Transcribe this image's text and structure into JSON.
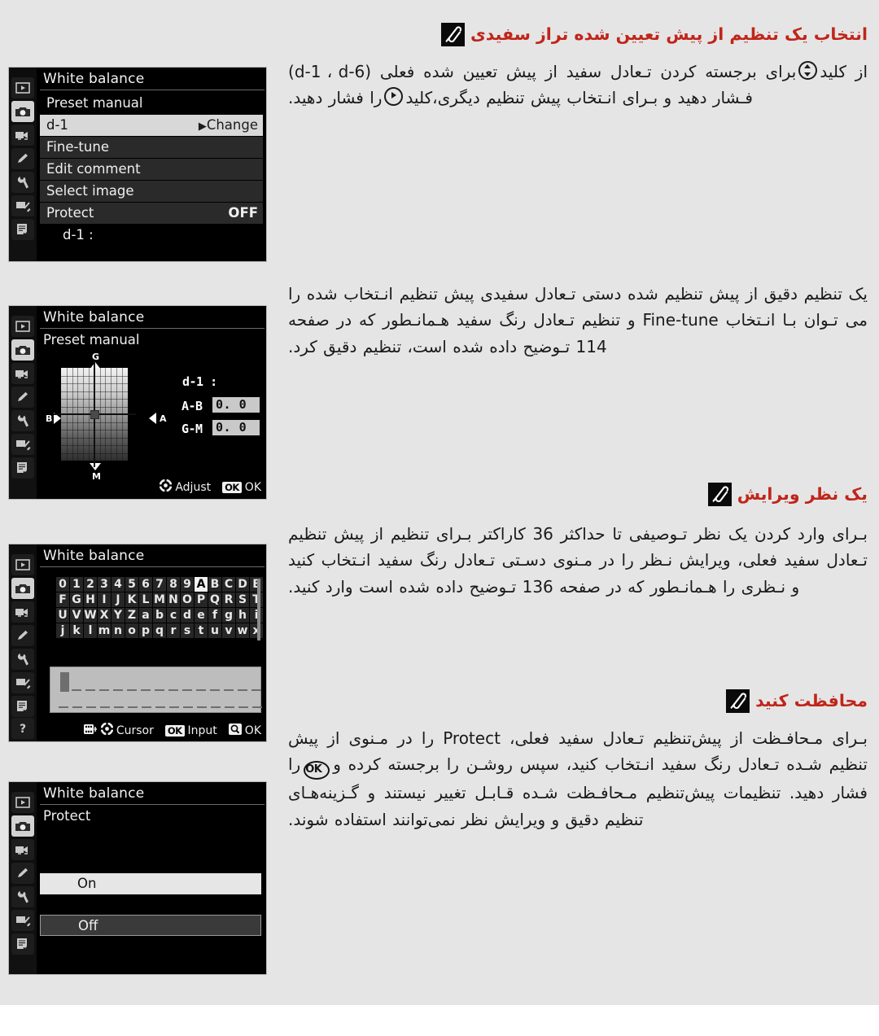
{
  "theme": {
    "page_bg": "#e5e5e5",
    "heading_red": "#c0251a",
    "lcd_black": "#000000",
    "highlight_gray": "#d8d8d8"
  },
  "sections": [
    {
      "heading": "انتخاب یک تنظیم از پیش تعیین شده تراز سفیدی",
      "paragraph_parts": {
        "a": "از کلید",
        "b": "برای برجسته کردن تـعادل سفید از پیش تعیین شده فعلی (",
        "c": "d-1 ، d-6",
        "d": ") فـشار دهید و بـرای انـتخاب پیش تنظیم دیگری،کلید",
        "e": "را فشار دهید."
      }
    },
    {
      "heading": "",
      "paragraph": "یک تنظیم دقیق از پیش تنظیم شده دستی تـعادل سفیدی پیش تنظیم انـتخاب شده را می تـوان بـا انـتخاب Fine-tune و تنظیم تـعادل رنگ سفید هـمانـطور که در صفحه 114 تـوضیح داده شده است، تنظیم دقیق کرد."
    },
    {
      "heading": "یک نظر ویرایش",
      "paragraph": "بـرای وارد کردن یک نظر تـوصیفی تا حداکثر 36 کاراکتر بـرای تنظیم از پیش تنظیم تـعادل سفید فعلی، ویرایش نـظر را در مـنوی دسـتی تـعادل رنگ سفید انـتخاب کنید و نـظری را هـمانـطور که در صفحه 136 تـوضیح داده شده است وارد کنید."
    },
    {
      "heading": "محافظت کنید",
      "paragraph_parts": {
        "a": "بـرای مـحافـظت از پیش‌تنظیم تـعادل سفید فعلی، Protect را در مـنوی از پیش تنظیم شـده تـعادل رنگ سفید انـتخاب کنید، سپس روشـن را برجسته کرده و",
        "b": "را فشار دهید. تنظیمات پیش‌تنظیم مـحافـظت شـده قـابـل تغییر نیستند و گـزینه‌هـای تنظیم دقیق و ویرایش نظر نمی‌توانند استفاده شوند."
      }
    }
  ],
  "sidebar_icons": [
    "playback-icon",
    "shooting-menu-icon",
    "movie-icon",
    "pencil-icon",
    "wrench-icon",
    "retouch-icon",
    "recent-settings-icon"
  ],
  "screens": [
    {
      "id": "preset-manual-menu",
      "title": "White balance",
      "subtitle": "Preset manual",
      "rows": [
        {
          "label": "d-1",
          "right": "Change",
          "state": "highlighted",
          "caret": "▶"
        },
        {
          "label": "Fine-tune",
          "right": "",
          "state": "normal"
        },
        {
          "label": "Edit comment",
          "right": "",
          "state": "normal"
        },
        {
          "label": "Select image",
          "right": "",
          "state": "normal"
        },
        {
          "label": "Protect",
          "right": "OFF",
          "state": "normal"
        }
      ],
      "footer_label": "d-1 :"
    },
    {
      "id": "fine-tune",
      "title": "White balance",
      "subtitle": "Preset manual",
      "axis_labels": {
        "top": "G",
        "bottom": "M",
        "left": "B",
        "right": "A"
      },
      "preset_label": "d-1 :",
      "values": [
        {
          "name": "A-B",
          "value": "0. 0"
        },
        {
          "name": "G-M",
          "value": "0. 0"
        }
      ],
      "footer": {
        "adjust": "Adjust",
        "ok_chip": "OK",
        "ok": "OK"
      }
    },
    {
      "id": "edit-comment",
      "title": "White balance",
      "keyboard_rows": [
        [
          "0",
          "1",
          "2",
          "3",
          "4",
          "5",
          "6",
          "7",
          "8",
          "9",
          "A",
          "B",
          "C",
          "D",
          "E"
        ],
        [
          "F",
          "G",
          "H",
          "I",
          "J",
          "K",
          "L",
          "M",
          "N",
          "O",
          "P",
          "Q",
          "R",
          "S",
          "T"
        ],
        [
          "U",
          "V",
          "W",
          "X",
          "Y",
          "Z",
          "a",
          "b",
          "c",
          "d",
          "e",
          "f",
          "g",
          "h",
          "i"
        ],
        [
          "j",
          "k",
          "l",
          "m",
          "n",
          "o",
          "p",
          "q",
          "r",
          "s",
          "t",
          "u",
          "v",
          "w",
          "x"
        ]
      ],
      "selected_key": "A",
      "text_value": "",
      "footer": {
        "cursor": "Cursor",
        "input_chip": "OK",
        "input": "Input",
        "ok": "OK"
      }
    },
    {
      "id": "protect",
      "title": "White balance",
      "subtitle": "Protect",
      "options": [
        {
          "label": "On",
          "state": "selected"
        },
        {
          "label": "Off",
          "state": "focused"
        }
      ]
    }
  ]
}
